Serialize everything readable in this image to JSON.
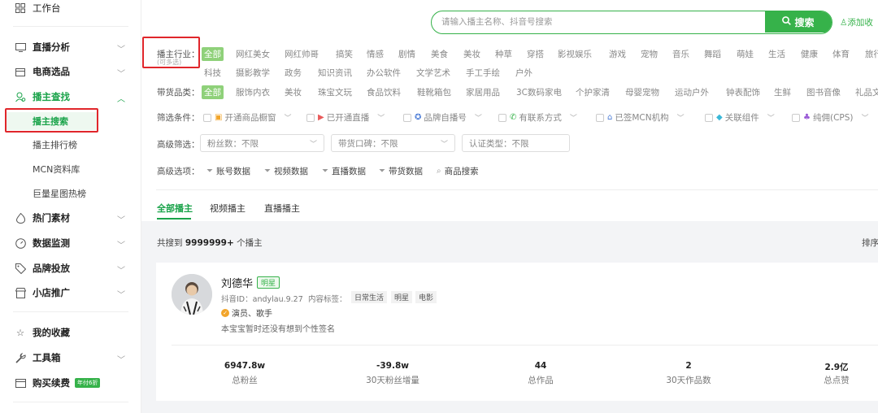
{
  "sidebar": {
    "workbench": "工作台",
    "items": [
      {
        "label": "直播分析"
      },
      {
        "label": "电商选品"
      },
      {
        "label": "播主查找"
      },
      {
        "label": "热门素材"
      },
      {
        "label": "数据监测"
      },
      {
        "label": "品牌投放"
      },
      {
        "label": "小店推广"
      },
      {
        "label": "我的收藏"
      },
      {
        "label": "工具箱"
      },
      {
        "label": "购买续费"
      }
    ],
    "purchase_badge": "年付6折",
    "sub_items": [
      "播主搜索",
      "播主排行榜",
      "MCN资料库",
      "巨量星图热榜"
    ]
  },
  "search": {
    "placeholder": "请输入播主名称、抖音号搜索",
    "button": "搜索",
    "add_favorite": "添加收"
  },
  "filters": {
    "industry_label": "播主行业：",
    "industry_sub": "(可多选)",
    "industry_row1": [
      "全部",
      "网红美女",
      "网红帅哥",
      "搞笑",
      "情感",
      "剧情",
      "美食",
      "美妆",
      "种草",
      "穿搭",
      "影视娱乐",
      "游戏",
      "宠物",
      "音乐",
      "舞蹈",
      "萌娃",
      "生活",
      "健康",
      "体育",
      "旅行"
    ],
    "industry_row2": [
      "科技",
      "摄影教学",
      "政务",
      "知识资讯",
      "办公软件",
      "文学艺术",
      "手工手绘",
      "户外"
    ],
    "goods_label": "带货品类：",
    "goods": [
      "全部",
      "服饰内衣",
      "美妆",
      "珠宝文玩",
      "食品饮料",
      "鞋靴箱包",
      "家居用品",
      "3C数码家电",
      "个护家清",
      "母婴宠物",
      "运动户外",
      "钟表配饰",
      "生鲜",
      "图书音像",
      "礼品文"
    ],
    "conditions_label": "筛选条件：",
    "conditions": [
      "开通商品橱窗",
      "已开通直播",
      "品牌自播号",
      "有联系方式",
      "已签MCN机构",
      "关联组件",
      "纯佣(CPS)"
    ],
    "advanced_label": "高级筛选：",
    "selects": [
      "粉丝数：不限",
      "带货口碑：不限",
      "认证类型：不限"
    ],
    "options_label": "高级选项：",
    "options": [
      "账号数据",
      "视频数据",
      "直播数据",
      "带货数据",
      "商品搜索"
    ]
  },
  "tabs": [
    "全部播主",
    "视频播主",
    "直播播主"
  ],
  "results": {
    "prefix": "共搜到",
    "count": "9999999+",
    "suffix": "个播主",
    "sort": "排序"
  },
  "card": {
    "name": "刘德华",
    "badge": "明星",
    "douyin_id": "抖音ID：andylau.9.27",
    "content_tags_label": "内容标签：",
    "content_tags": [
      "日常生活",
      "明星",
      "电影"
    ],
    "role": "演员、歌手",
    "signature": "本宝宝暂时还没有想到个性签名",
    "stats": [
      {
        "value": "6947.8w",
        "label": "总粉丝"
      },
      {
        "value": "-39.8w",
        "label": "30天粉丝增量"
      },
      {
        "value": "44",
        "label": "总作品"
      },
      {
        "value": "2",
        "label": "30天作品数"
      },
      {
        "value": "2.9亿",
        "label": "总点赞"
      }
    ]
  },
  "colors": {
    "accent": "#36b24a",
    "highlight": "#e0262b"
  }
}
